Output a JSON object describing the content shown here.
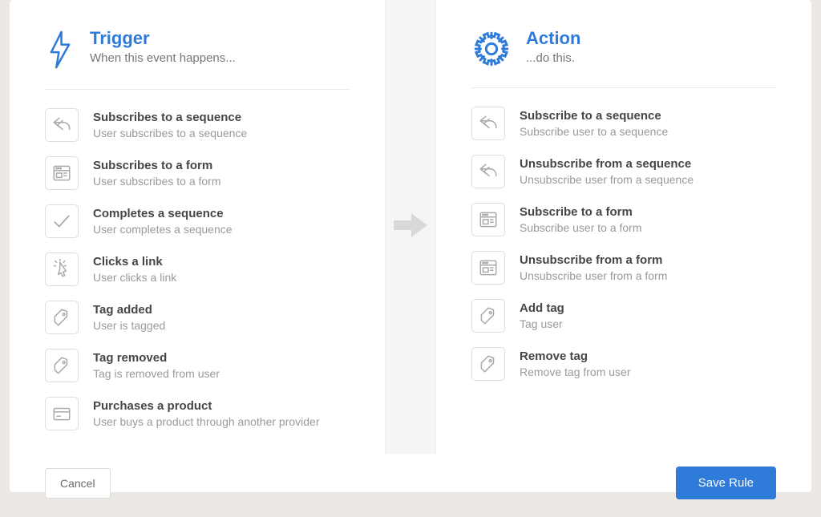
{
  "trigger": {
    "title": "Trigger",
    "subtitle": "When this event happens...",
    "items": [
      {
        "icon": "reply",
        "title": "Subscribes to a sequence",
        "desc": "User subscribes to a sequence"
      },
      {
        "icon": "form",
        "title": "Subscribes to a form",
        "desc": "User subscribes to a form"
      },
      {
        "icon": "check",
        "title": "Completes a sequence",
        "desc": "User completes a sequence"
      },
      {
        "icon": "click",
        "title": "Clicks a link",
        "desc": "User clicks a link"
      },
      {
        "icon": "tag",
        "title": "Tag added",
        "desc": "User is tagged"
      },
      {
        "icon": "tag",
        "title": "Tag removed",
        "desc": "Tag is removed from user"
      },
      {
        "icon": "card",
        "title": "Purchases a product",
        "desc": "User buys a product through another provider"
      }
    ]
  },
  "action": {
    "title": "Action",
    "subtitle": "...do this.",
    "items": [
      {
        "icon": "reply",
        "title": "Subscribe to a sequence",
        "desc": "Subscribe user to a sequence"
      },
      {
        "icon": "reply",
        "title": "Unsubscribe from a sequence",
        "desc": "Unsubscribe user from a sequence"
      },
      {
        "icon": "form",
        "title": "Subscribe to a form",
        "desc": "Subscribe user to a form"
      },
      {
        "icon": "form",
        "title": "Unsubscribe from a form",
        "desc": "Unsubscribe user from a form"
      },
      {
        "icon": "tag",
        "title": "Add tag",
        "desc": "Tag user"
      },
      {
        "icon": "tag",
        "title": "Remove tag",
        "desc": "Remove tag from user"
      }
    ]
  },
  "footer": {
    "cancel": "Cancel",
    "save": "Save Rule"
  }
}
